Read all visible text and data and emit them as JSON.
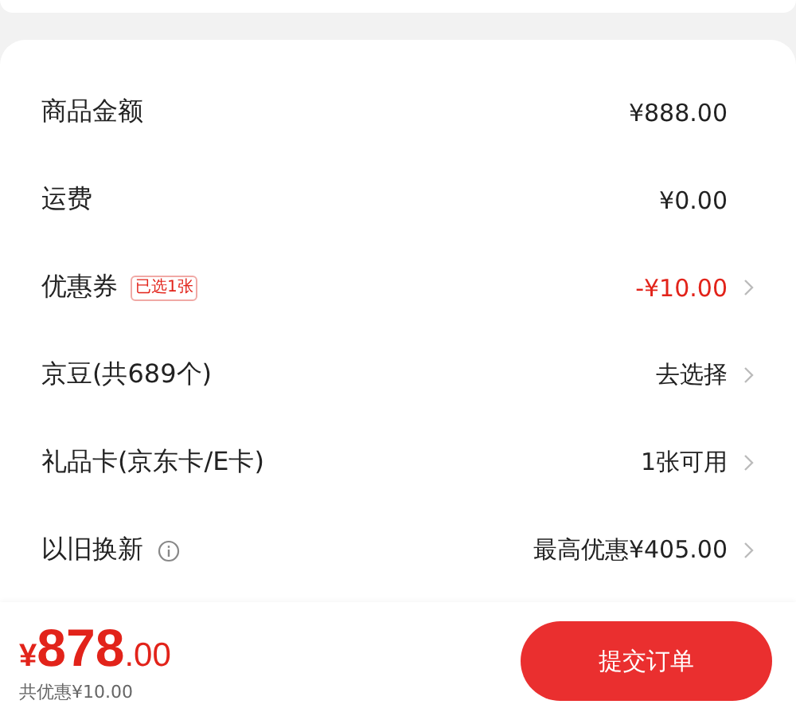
{
  "summary_rows": [
    {
      "label": "商品金额",
      "value": "¥888.00",
      "highlight": false,
      "chevron": false
    },
    {
      "label": "运费",
      "value": "¥0.00",
      "highlight": false,
      "chevron": false
    },
    {
      "label": "优惠券",
      "tag": "已选1张",
      "value": "-¥10.00",
      "highlight": true,
      "chevron": true
    },
    {
      "label": "京豆(共689个)",
      "value": "去选择",
      "highlight": false,
      "chevron": true
    },
    {
      "label": "礼品卡(京东卡/E卡)",
      "value": "1张可用",
      "highlight": false,
      "chevron": true
    },
    {
      "label": "以旧换新",
      "info": true,
      "value": "最高优惠¥405.00",
      "highlight": false,
      "chevron": true
    }
  ],
  "footer": {
    "currency": "¥",
    "total_integer": "878",
    "total_decimal": ".00",
    "savings": "共优惠¥10.00",
    "submit_button": "提交订单"
  }
}
